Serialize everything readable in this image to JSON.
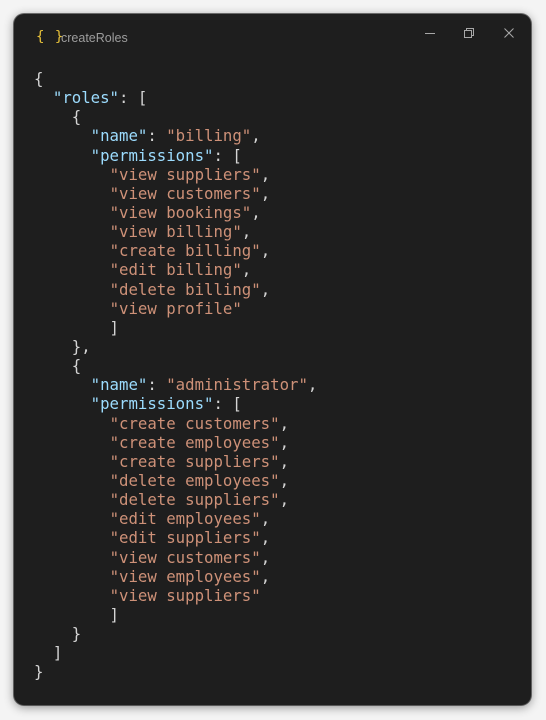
{
  "window": {
    "title": "createRoles",
    "icon": "braces-icon",
    "icon_glyph": "{ }",
    "accent_color": "#e8c23a",
    "background_color": "#1e1e1e",
    "key_color": "#9cdcfe",
    "string_color": "#ce9178",
    "punctuation_color": "#d4d4d4"
  },
  "controls": [
    "minimize-icon",
    "restore-icon",
    "close-icon"
  ],
  "code": {
    "lines": [
      [
        {
          "t": "p",
          "v": "{"
        }
      ],
      [
        {
          "t": "p",
          "v": "  "
        },
        {
          "t": "k",
          "v": "\"roles\""
        },
        {
          "t": "p",
          "v": ": ["
        }
      ],
      [
        {
          "t": "p",
          "v": "    {"
        }
      ],
      [
        {
          "t": "p",
          "v": "      "
        },
        {
          "t": "k",
          "v": "\"name\""
        },
        {
          "t": "p",
          "v": ": "
        },
        {
          "t": "s",
          "v": "\"billing\""
        },
        {
          "t": "p",
          "v": ","
        }
      ],
      [
        {
          "t": "p",
          "v": "      "
        },
        {
          "t": "k",
          "v": "\"permissions\""
        },
        {
          "t": "p",
          "v": ": ["
        }
      ],
      [
        {
          "t": "p",
          "v": "        "
        },
        {
          "t": "s",
          "v": "\"view suppliers\""
        },
        {
          "t": "p",
          "v": ","
        }
      ],
      [
        {
          "t": "p",
          "v": "        "
        },
        {
          "t": "s",
          "v": "\"view customers\""
        },
        {
          "t": "p",
          "v": ","
        }
      ],
      [
        {
          "t": "p",
          "v": "        "
        },
        {
          "t": "s",
          "v": "\"view bookings\""
        },
        {
          "t": "p",
          "v": ","
        }
      ],
      [
        {
          "t": "p",
          "v": "        "
        },
        {
          "t": "s",
          "v": "\"view billing\""
        },
        {
          "t": "p",
          "v": ","
        }
      ],
      [
        {
          "t": "p",
          "v": "        "
        },
        {
          "t": "s",
          "v": "\"create billing\""
        },
        {
          "t": "p",
          "v": ","
        }
      ],
      [
        {
          "t": "p",
          "v": "        "
        },
        {
          "t": "s",
          "v": "\"edit billing\""
        },
        {
          "t": "p",
          "v": ","
        }
      ],
      [
        {
          "t": "p",
          "v": "        "
        },
        {
          "t": "s",
          "v": "\"delete billing\""
        },
        {
          "t": "p",
          "v": ","
        }
      ],
      [
        {
          "t": "p",
          "v": "        "
        },
        {
          "t": "s",
          "v": "\"view profile\""
        }
      ],
      [
        {
          "t": "p",
          "v": "        ]"
        }
      ],
      [
        {
          "t": "p",
          "v": "    },"
        }
      ],
      [
        {
          "t": "p",
          "v": "    {"
        }
      ],
      [
        {
          "t": "p",
          "v": "      "
        },
        {
          "t": "k",
          "v": "\"name\""
        },
        {
          "t": "p",
          "v": ": "
        },
        {
          "t": "s",
          "v": "\"administrator\""
        },
        {
          "t": "p",
          "v": ","
        }
      ],
      [
        {
          "t": "p",
          "v": "      "
        },
        {
          "t": "k",
          "v": "\"permissions\""
        },
        {
          "t": "p",
          "v": ": ["
        }
      ],
      [
        {
          "t": "p",
          "v": "        "
        },
        {
          "t": "s",
          "v": "\"create customers\""
        },
        {
          "t": "p",
          "v": ","
        }
      ],
      [
        {
          "t": "p",
          "v": "        "
        },
        {
          "t": "s",
          "v": "\"create employees\""
        },
        {
          "t": "p",
          "v": ","
        }
      ],
      [
        {
          "t": "p",
          "v": "        "
        },
        {
          "t": "s",
          "v": "\"create suppliers\""
        },
        {
          "t": "p",
          "v": ","
        }
      ],
      [
        {
          "t": "p",
          "v": "        "
        },
        {
          "t": "s",
          "v": "\"delete employees\""
        },
        {
          "t": "p",
          "v": ","
        }
      ],
      [
        {
          "t": "p",
          "v": "        "
        },
        {
          "t": "s",
          "v": "\"delete suppliers\""
        },
        {
          "t": "p",
          "v": ","
        }
      ],
      [
        {
          "t": "p",
          "v": "        "
        },
        {
          "t": "s",
          "v": "\"edit employees\""
        },
        {
          "t": "p",
          "v": ","
        }
      ],
      [
        {
          "t": "p",
          "v": "        "
        },
        {
          "t": "s",
          "v": "\"edit suppliers\""
        },
        {
          "t": "p",
          "v": ","
        }
      ],
      [
        {
          "t": "p",
          "v": "        "
        },
        {
          "t": "s",
          "v": "\"view customers\""
        },
        {
          "t": "p",
          "v": ","
        }
      ],
      [
        {
          "t": "p",
          "v": "        "
        },
        {
          "t": "s",
          "v": "\"view employees\""
        },
        {
          "t": "p",
          "v": ","
        }
      ],
      [
        {
          "t": "p",
          "v": "        "
        },
        {
          "t": "s",
          "v": "\"view suppliers\""
        }
      ],
      [
        {
          "t": "p",
          "v": "        ]"
        }
      ],
      [
        {
          "t": "p",
          "v": "    }"
        }
      ],
      [
        {
          "t": "p",
          "v": "  ]"
        }
      ],
      [
        {
          "t": "p",
          "v": "}"
        }
      ]
    ]
  }
}
